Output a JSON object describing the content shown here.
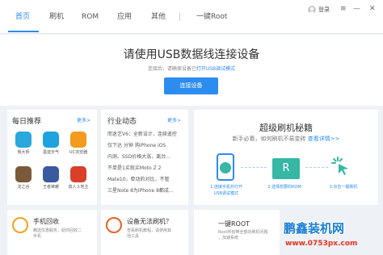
{
  "nav": {
    "tabs": [
      {
        "label": "首页",
        "active": true
      },
      {
        "label": "刷机",
        "active": false
      },
      {
        "label": "ROM",
        "active": false
      },
      {
        "label": "应用",
        "active": false
      },
      {
        "label": "其他",
        "active": false
      },
      {
        "label": "一键Root",
        "active": false
      }
    ],
    "login_label": "登录",
    "menu_glyph": "≡",
    "minimize_glyph": "—",
    "close_glyph": "✕"
  },
  "hero": {
    "title": "请使用USB数据线连接设备",
    "sub_text": "连接后，请确保设备已",
    "sub_link": "打开USB调试模式",
    "button": "连接设备"
  },
  "daily": {
    "title": "每日推荐",
    "more": "更多>",
    "apps": [
      {
        "name": "我大师",
        "color": "#2aa7dd"
      },
      {
        "name": "墨迹天气",
        "color": "#1fa2e0"
      },
      {
        "name": "UC浏览器",
        "color": "#f39a1f"
      },
      {
        "name": "龙之谷",
        "color": "#7a5a3a"
      },
      {
        "name": "王者荣耀",
        "color": "#3a5aa0"
      },
      {
        "name": "真人斗地主",
        "color": "#d8402a"
      }
    ]
  },
  "industry": {
    "title": "行业动态",
    "more": "更多>",
    "items": [
      "而迷艺V6：全新设计，连续遥控",
      "仅下达 分钟 购iPhone iOS",
      "内测、SSD价格大涨，离台...",
      "不单是1买就买Moto Z 2",
      "Mate10，牵动的对比，不管",
      "三星Note 8为iPhone 8都成..."
    ]
  },
  "secret": {
    "title": "超级刷机秘籍",
    "sub": "新手必看，如何刷机不易变砖",
    "sub_link": "查看详情>>",
    "steps": [
      {
        "label": "1.连接手机并打开",
        "label2": "USB调试模式"
      },
      {
        "label": "2.选择想要的ROM",
        "label2": ""
      },
      {
        "label": "3.点击一键刷机",
        "label2": ""
      }
    ],
    "rom_letter": "R"
  },
  "bottom": [
    {
      "title": "手机回收",
      "desc1": "精选优惠服务，助你回收二",
      "desc2": "手机",
      "color": "#f3a21a"
    },
    {
      "title": "设备无法刷机？",
      "desc1": "查看刷机教程，请使用其",
      "desc2": "他工具",
      "color": "#f2c9a0"
    },
    {
      "title": "一键ROOT",
      "desc1": "Root所有带全部的刷机问题",
      "desc2": "，加速系统",
      "color": "#f2f2f2"
    }
  ],
  "watermark": {
    "cn": "鹏鑫装机网",
    "url": "www.0753px.com"
  },
  "colors": {
    "accent": "#2d8cf0",
    "teal": "#37b7a6",
    "watermark_blue": "#1a7fd4",
    "watermark_red": "#e8321e"
  }
}
